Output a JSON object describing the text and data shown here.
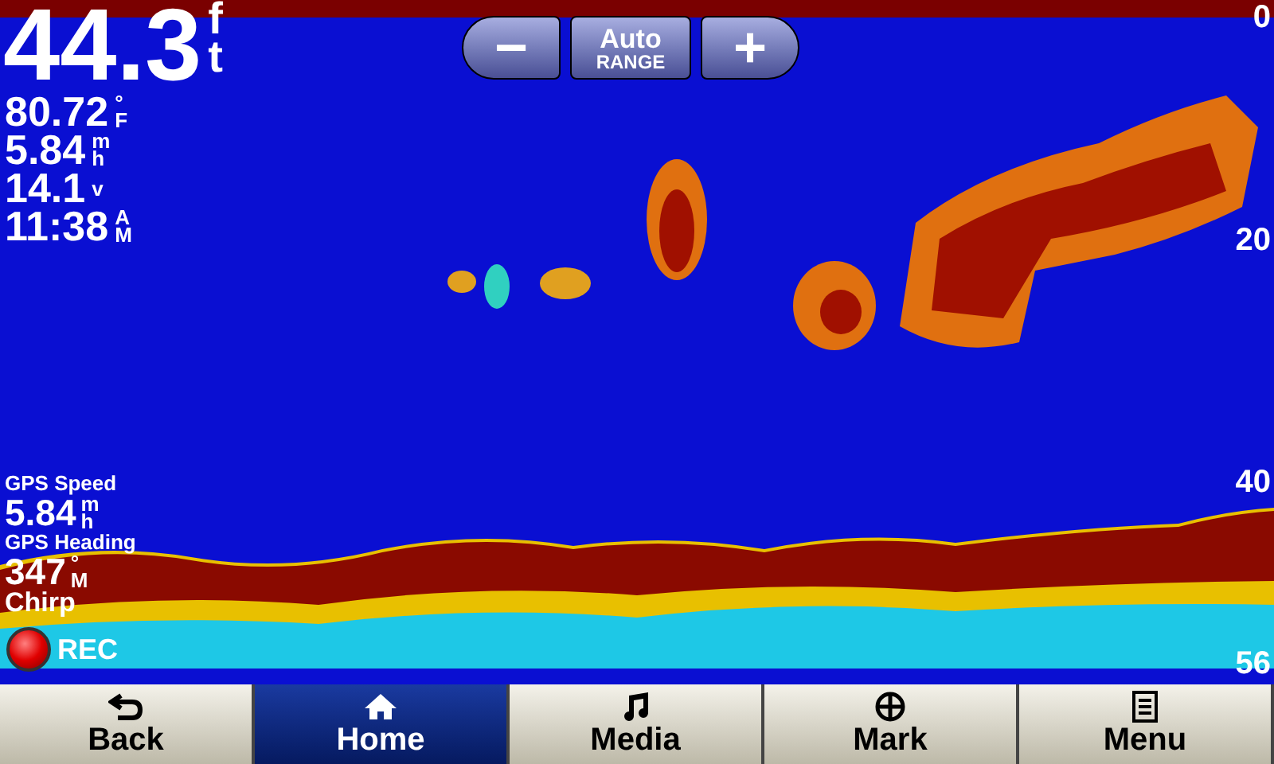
{
  "depth": {
    "value": "44.3",
    "unit": [
      "f",
      "t"
    ]
  },
  "readings": [
    {
      "value": "80.72",
      "unit": [
        "°",
        "F"
      ]
    },
    {
      "value": "5.84",
      "unit": [
        "m",
        "h"
      ]
    },
    {
      "value": "14.1",
      "unit": [
        "v"
      ]
    },
    {
      "value": "11:38",
      "unit": [
        "A",
        "M"
      ]
    }
  ],
  "range_controls": {
    "minus": "−",
    "auto": "Auto",
    "range": "RANGE",
    "plus": "+"
  },
  "depth_scale": [
    "0",
    "20",
    "40",
    "56"
  ],
  "gps": [
    {
      "label": "GPS Speed",
      "value": "5.84",
      "unit": [
        "m",
        "h"
      ]
    },
    {
      "label": "GPS Heading",
      "value": "347",
      "unit": [
        "°",
        "M"
      ]
    }
  ],
  "mode": "Chirp",
  "record": {
    "label": "REC",
    "on": true
  },
  "nav": [
    {
      "label": "Back",
      "selected": false
    },
    {
      "label": "Home",
      "selected": true
    },
    {
      "label": "Media",
      "selected": false
    },
    {
      "label": "Mark",
      "selected": false
    },
    {
      "label": "Menu",
      "selected": false
    }
  ]
}
